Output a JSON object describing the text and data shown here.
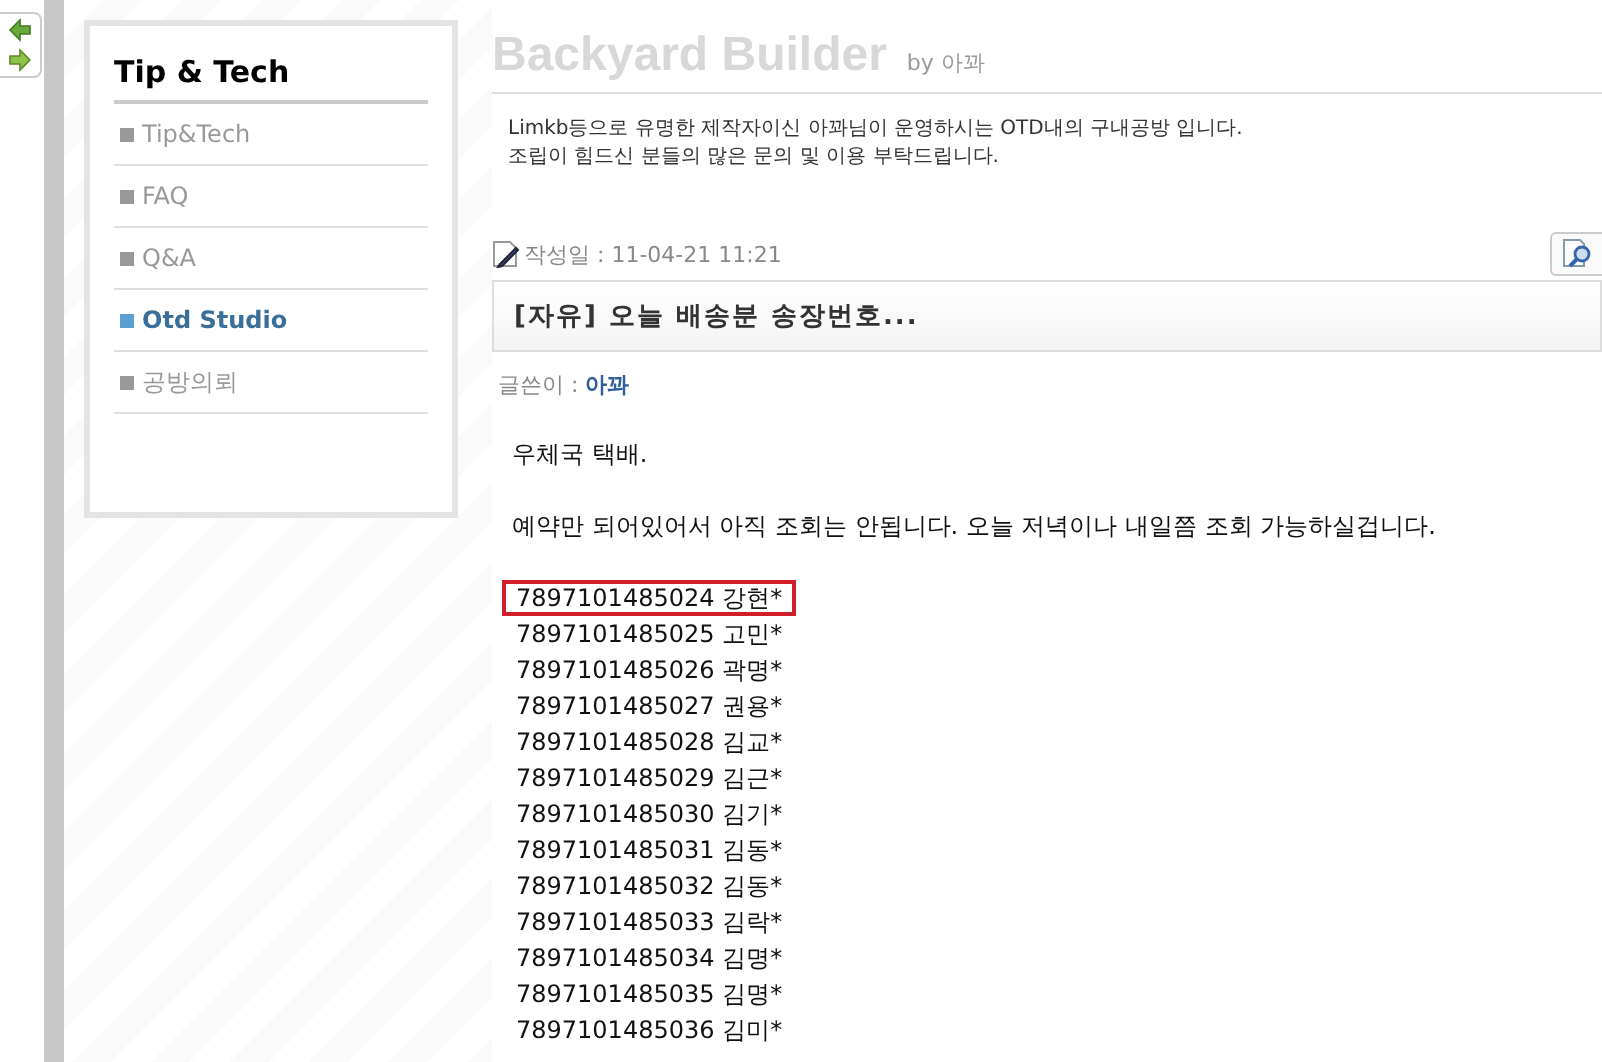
{
  "sidebar": {
    "title": "Tip & Tech",
    "items": [
      {
        "label": "Tip&Tech",
        "selected": false
      },
      {
        "label": "FAQ",
        "selected": false
      },
      {
        "label": "Q&A",
        "selected": false
      },
      {
        "label": "Otd Studio",
        "selected": true
      },
      {
        "label": "공방의뢰",
        "selected": false
      }
    ]
  },
  "header": {
    "title": "Backyard Builder",
    "byline": "by 아꽈",
    "description": [
      "Limkb등으로 유명한 제작자이신 아꽈님이 운영하시는 OTD내의 구내공방 입니다.",
      "조립이 힘드신 분들의 많은 문의 및 이용 부탁드립니다."
    ]
  },
  "post": {
    "date_label": "작성일 : 11-04-21 11:21",
    "title": "[자유] 오늘 배송분 송장번호...",
    "author_label": "글쓴이 :",
    "author": "아꽈",
    "body": [
      "우체국 택배.",
      "예약만 되어있어서 아직 조회는 안됩니다. 오늘 저녁이나 내일쯤 조회 가능하실겁니다."
    ],
    "tracking": [
      {
        "text": "7897101485024 강현*",
        "highlighted": true
      },
      {
        "text": "7897101485025 고민*",
        "highlighted": false
      },
      {
        "text": "7897101485026 곽명*",
        "highlighted": false
      },
      {
        "text": "7897101485027 권용*",
        "highlighted": false
      },
      {
        "text": "7897101485028 김교*",
        "highlighted": false
      },
      {
        "text": "7897101485029 김근*",
        "highlighted": false
      },
      {
        "text": "7897101485030 김기*",
        "highlighted": false
      },
      {
        "text": "7897101485031 김동*",
        "highlighted": false
      },
      {
        "text": "7897101485032 김동*",
        "highlighted": false
      },
      {
        "text": "7897101485033 김락*",
        "highlighted": false
      },
      {
        "text": "7897101485034 김명*",
        "highlighted": false
      },
      {
        "text": "7897101485035 김명*",
        "highlighted": false
      },
      {
        "text": "7897101485036 김미*",
        "highlighted": false
      }
    ]
  }
}
